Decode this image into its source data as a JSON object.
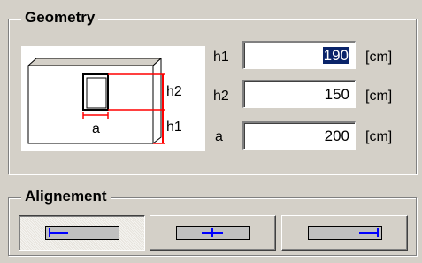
{
  "geometry": {
    "title": "Geometry",
    "diagram": {
      "label_h2": "h2",
      "label_h1": "h1",
      "label_a": "a"
    },
    "fields": [
      {
        "label": "h1",
        "value": "190",
        "unit": "[cm]",
        "selected": true
      },
      {
        "label": "h2",
        "value": "150",
        "unit": "[cm]"
      },
      {
        "label": "a",
        "value": "200",
        "unit": "[cm]"
      }
    ]
  },
  "alignement": {
    "title": "Alignement",
    "buttons": [
      {
        "name": "align-left-icon",
        "pressed": true
      },
      {
        "name": "align-center-icon",
        "pressed": false
      },
      {
        "name": "align-right-icon",
        "pressed": false
      }
    ]
  },
  "colors": {
    "dialog_bg": "#d4d0c8",
    "dimension_red": "#ff0000",
    "selection_blue": "#0a246a",
    "icon_blue": "#0000ff"
  }
}
